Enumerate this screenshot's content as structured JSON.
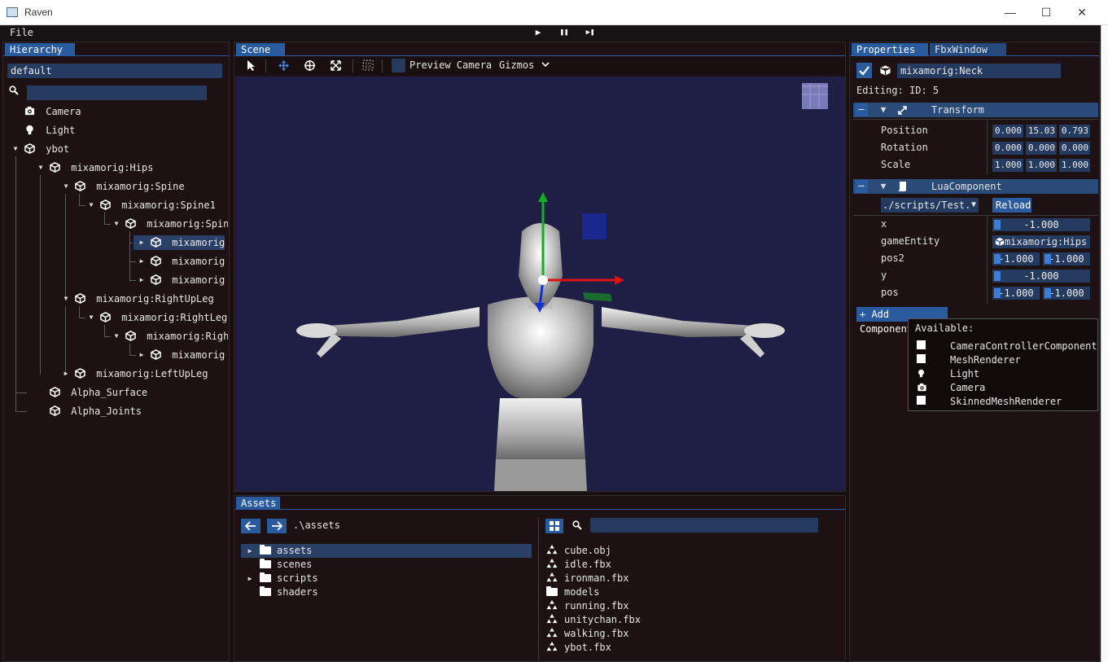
{
  "window": {
    "title": "Raven",
    "minimize": "—",
    "maximize": "☐",
    "close": "✕"
  },
  "menu": {
    "file": "File",
    "play": "▶",
    "pause": "❚❚",
    "step": "▶❚"
  },
  "hierarchy": {
    "tab": "Hierarchy",
    "scene_name": "default",
    "search_placeholder": "",
    "items": [
      {
        "label": "Camera"
      },
      {
        "label": "Light"
      },
      {
        "label": "ybot"
      },
      {
        "label": "mixamorig:Hips"
      },
      {
        "label": "mixamorig:Spine"
      },
      {
        "label": "mixamorig:Spine1"
      },
      {
        "label": "mixamorig:Spine"
      },
      {
        "label": "mixamorig:"
      },
      {
        "label": "mixamorig:"
      },
      {
        "label": "mixamorig:"
      },
      {
        "label": "mixamorig:RightUpLeg"
      },
      {
        "label": "mixamorig:RightLeg"
      },
      {
        "label": "mixamorig:Right"
      },
      {
        "label": "mixamorig:"
      },
      {
        "label": "mixamorig:LeftUpLeg"
      },
      {
        "label": "Alpha_Surface"
      },
      {
        "label": "Alpha_Joints"
      }
    ]
  },
  "scene": {
    "tab": "Scene",
    "preview_camera": "Preview Camera",
    "gizmos": "Gizmos",
    "colors": {
      "background": "#1f1f45",
      "gizmo_x": "#e01010",
      "gizmo_y": "#10b020",
      "gizmo_z": "#1030d0"
    }
  },
  "assets": {
    "tab": "Assets",
    "path": ".\\assets",
    "search_placeholder": "",
    "folders": [
      {
        "label": "assets",
        "expandable": true,
        "selected": true
      },
      {
        "label": "scenes",
        "expandable": false
      },
      {
        "label": "scripts",
        "expandable": true
      },
      {
        "label": "shaders",
        "expandable": false
      }
    ],
    "files": [
      {
        "label": "cube.obj",
        "icon": "mesh-icon"
      },
      {
        "label": "idle.fbx",
        "icon": "mesh-icon"
      },
      {
        "label": "ironman.fbx",
        "icon": "mesh-icon"
      },
      {
        "label": "models",
        "icon": "folder-icon"
      },
      {
        "label": "running.fbx",
        "icon": "mesh-icon"
      },
      {
        "label": "unitychan.fbx",
        "icon": "mesh-icon"
      },
      {
        "label": "walking.fbx",
        "icon": "mesh-icon"
      },
      {
        "label": "ybot.fbx",
        "icon": "mesh-icon"
      }
    ]
  },
  "properties": {
    "tab_active": "Properties",
    "tab_inactive": "FbxWindow",
    "entity_name": "mixamorig:Neck",
    "editing": "Editing: ID: 5",
    "transform": {
      "title": "Transform",
      "position_label": "Position",
      "rotation_label": "Rotation",
      "scale_label": "Scale",
      "position": [
        "0.000",
        "15.03",
        "0.793"
      ],
      "rotation": [
        "0.000",
        "0.000",
        "0.000"
      ],
      "scale": [
        "1.000",
        "1.000",
        "1.000"
      ]
    },
    "lua": {
      "title": "LuaComponent",
      "script": "./scripts/Test.",
      "reload": "Reload",
      "x_label": "x",
      "x_value": "-1.000",
      "game_entity_label": "gameEntity",
      "game_entity_value": "mixamorig:Hips",
      "pos2_label": "pos2",
      "pos2": [
        "-1.000",
        "-1.000"
      ],
      "y_label": "y",
      "y_value": "-1.000",
      "pos_label": "pos",
      "pos": [
        "-1.000",
        "-1.000"
      ]
    },
    "add_component": "+ Add Component",
    "available": {
      "title": "Available:",
      "items": [
        {
          "label": "CameraControllerComponent"
        },
        {
          "label": "MeshRenderer"
        },
        {
          "label": "Light"
        },
        {
          "label": "Camera"
        },
        {
          "label": "SkinnedMeshRenderer"
        }
      ]
    }
  }
}
